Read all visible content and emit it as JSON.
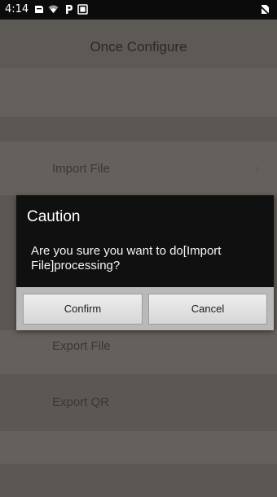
{
  "status_bar": {
    "time": "4:14",
    "icons": [
      "notification-icon",
      "wifi-icon",
      "p-icon",
      "screen-icon",
      "no-sim-icon"
    ]
  },
  "header": {
    "title": "Once Configure"
  },
  "list": {
    "items": [
      {
        "label": "Import File"
      },
      {
        "label": "Export File"
      },
      {
        "label": "Export QR"
      }
    ]
  },
  "dialog": {
    "title": "Caution",
    "message": "Are you sure you want to do[Import File]processing?",
    "confirm_label": "Confirm",
    "cancel_label": "Cancel"
  },
  "colors": {
    "status_bar_bg": "#0b0b0b",
    "background": "#5f5a56",
    "dialog_header_bg": "#101010",
    "dialog_text": "#ffffff",
    "button_bg": "#e3e3e3"
  }
}
